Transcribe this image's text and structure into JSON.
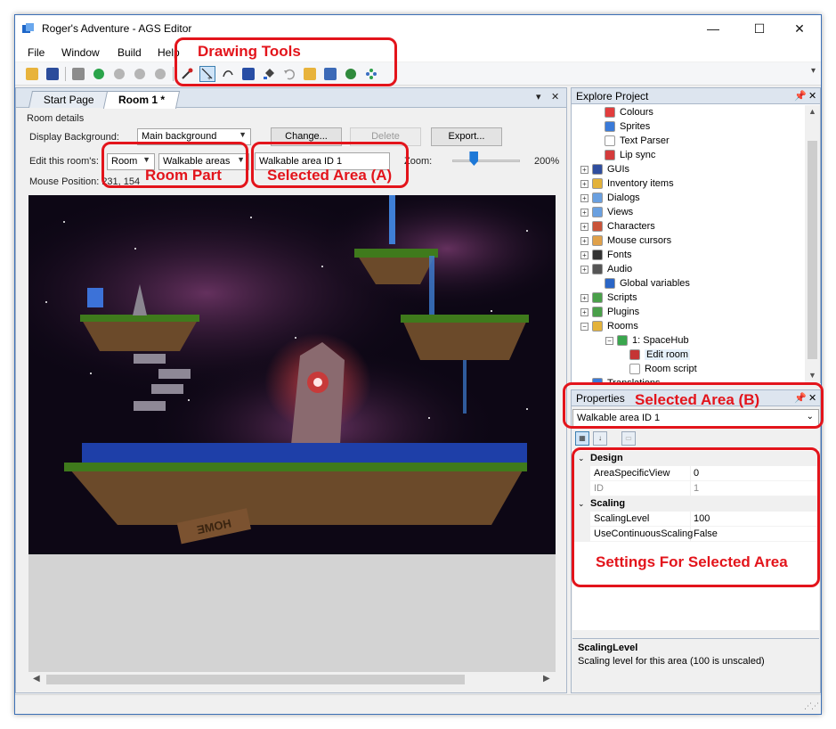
{
  "window": {
    "title": "Roger's Adventure - AGS Editor",
    "controls": {
      "minimize": "—",
      "maximize": "☐",
      "close": "✕"
    }
  },
  "menubar": {
    "items": [
      "File",
      "Window",
      "Build",
      "Help"
    ]
  },
  "toolbar": {
    "icons": [
      "open-folder-icon",
      "save-icon",
      "build-icon",
      "run-icon",
      "pause-icon",
      "stop-icon",
      "record-icon",
      "eyedropper-icon",
      "select-pointer-icon",
      "freehand-icon",
      "rectangle-icon",
      "fill-icon",
      "undo-icon",
      "import-icon",
      "import-mask-icon",
      "copy-walkable-icon",
      "grid-icon"
    ],
    "more": "▾"
  },
  "document_tabs": [
    {
      "label": "Start Page",
      "active": false
    },
    {
      "label": "Room 1 *",
      "active": true
    }
  ],
  "tab_controls": {
    "dropdown": "▾",
    "close": "✕"
  },
  "room_details": {
    "group_label": "Room details",
    "display_background_label": "Display Background:",
    "display_background_value": "Main background",
    "change_button": "Change...",
    "delete_button": "Delete",
    "export_button": "Export...",
    "edit_room_label": "Edit this room's:",
    "room_part_value": "Room",
    "room_layer_value": "Walkable areas",
    "selected_area_value": "Walkable area ID 1",
    "zoom_label": "Zoom:",
    "zoom_value": "200%",
    "zoom_level": 0.15,
    "mouse_position_label": "Mouse Position: 231, 154"
  },
  "room_scene": {
    "sign_text": "HOME",
    "colors": {
      "sky": "#0d0715",
      "nebula": "#5a2a55",
      "island": "#6b4a2a",
      "grass": "#3f7a1c",
      "water": "#1e3fa8",
      "portal": "#c73a3a"
    }
  },
  "explore_project": {
    "title": "Explore Project",
    "items": [
      {
        "label": "Colours",
        "icon": "palette-icon",
        "indent": 1,
        "expander": ""
      },
      {
        "label": "Sprites",
        "icon": "sprites-icon",
        "indent": 1,
        "expander": ""
      },
      {
        "label": "Text Parser",
        "icon": "text-parser-icon",
        "indent": 1,
        "expander": ""
      },
      {
        "label": "Lip sync",
        "icon": "lip-sync-icon",
        "indent": 1,
        "expander": ""
      },
      {
        "label": "GUIs",
        "icon": "gui-icon",
        "indent": 0,
        "expander": "+"
      },
      {
        "label": "Inventory items",
        "icon": "inventory-icon",
        "indent": 0,
        "expander": "+"
      },
      {
        "label": "Dialogs",
        "icon": "dialogs-icon",
        "indent": 0,
        "expander": "+"
      },
      {
        "label": "Views",
        "icon": "views-icon",
        "indent": 0,
        "expander": "+"
      },
      {
        "label": "Characters",
        "icon": "characters-icon",
        "indent": 0,
        "expander": "+"
      },
      {
        "label": "Mouse cursors",
        "icon": "mouse-cursor-icon",
        "indent": 0,
        "expander": "+"
      },
      {
        "label": "Fonts",
        "icon": "fonts-icon",
        "indent": 0,
        "expander": "+"
      },
      {
        "label": "Audio",
        "icon": "audio-icon",
        "indent": 0,
        "expander": "+"
      },
      {
        "label": "Global variables",
        "icon": "globe-icon",
        "indent": 1,
        "expander": ""
      },
      {
        "label": "Scripts",
        "icon": "scripts-icon",
        "indent": 0,
        "expander": "+"
      },
      {
        "label": "Plugins",
        "icon": "plugins-icon",
        "indent": 0,
        "expander": "+"
      },
      {
        "label": "Rooms",
        "icon": "rooms-icon",
        "indent": 0,
        "expander": "−"
      },
      {
        "label": "1: SpaceHub",
        "icon": "room-icon",
        "indent": 2,
        "expander": "−"
      },
      {
        "label": "Edit room",
        "icon": "edit-room-icon",
        "indent": 3,
        "expander": ""
      },
      {
        "label": "Room script",
        "icon": "script-file-icon",
        "indent": 3,
        "expander": ""
      },
      {
        "label": "Translations",
        "icon": "translations-icon",
        "indent": 0,
        "expander": ""
      }
    ]
  },
  "properties": {
    "title": "Properties",
    "selected_object": "Walkable area ID 1",
    "categories": [
      {
        "name": "Design",
        "rows": [
          {
            "name": "AreaSpecificView",
            "value": "0",
            "readonly": false
          },
          {
            "name": "ID",
            "value": "1",
            "readonly": true
          }
        ]
      },
      {
        "name": "Scaling",
        "rows": [
          {
            "name": "ScalingLevel",
            "value": "100",
            "readonly": false
          },
          {
            "name": "UseContinuousScaling",
            "value": "False",
            "readonly": false
          }
        ]
      }
    ],
    "help_title": "ScalingLevel",
    "help_description": "Scaling level for this area (100 is unscaled)"
  },
  "annotations": {
    "drawing_tools": "Drawing Tools",
    "room_part": "Room Part",
    "selected_area_a": "Selected Area (A)",
    "selected_area_b": "Selected Area (B)",
    "settings": "Settings For Selected Area",
    "color": "#e3141b"
  }
}
